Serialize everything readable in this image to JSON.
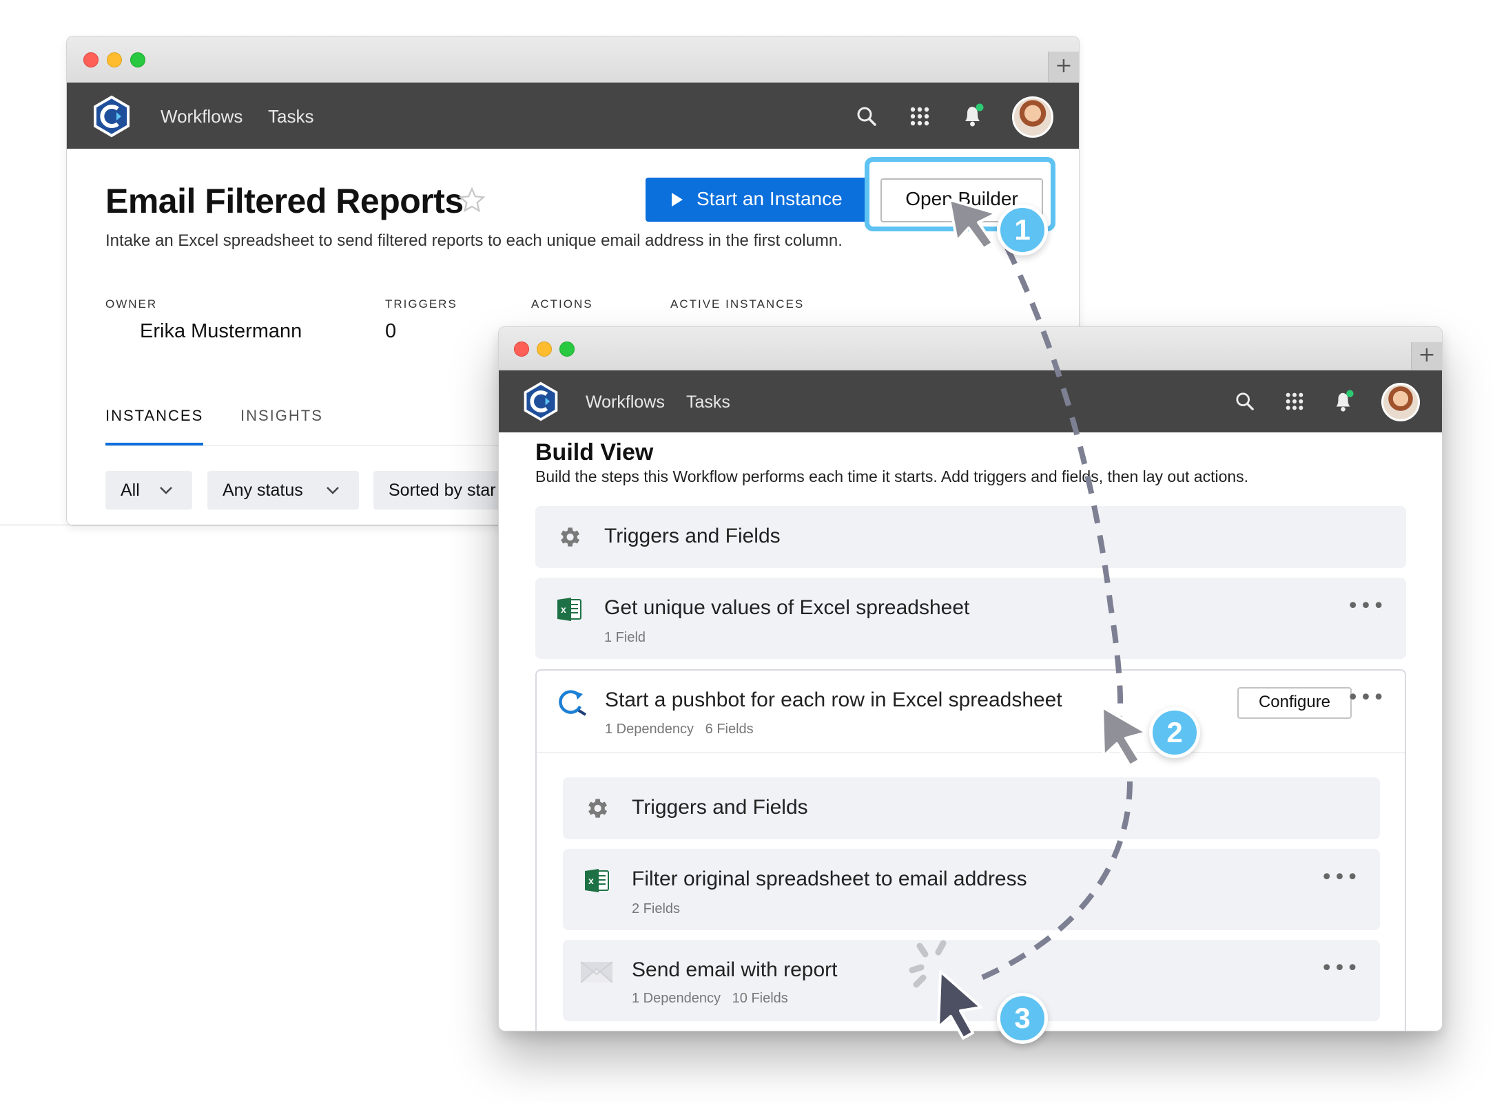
{
  "app": {
    "nav_links": [
      "Workflows",
      "Tasks"
    ],
    "icons": [
      "logo-icon",
      "search-icon",
      "apps-grid-icon",
      "bell-icon",
      "avatar"
    ],
    "accent_color": "#0b6fdc",
    "highlight_color": "#5ec2f2"
  },
  "overview": {
    "title": "Email Filtered Reports",
    "description": "Intake an Excel spreadsheet to send filtered reports to each unique email address in the first column.",
    "start_button": "Start an Instance",
    "open_builder_button": "Open Builder",
    "stats": [
      {
        "label": "OWNER",
        "value": "Erika Mustermann"
      },
      {
        "label": "TRIGGERS",
        "value": "0"
      },
      {
        "label": "ACTIONS",
        "value": ""
      },
      {
        "label": "ACTIVE INSTANCES",
        "value": ""
      }
    ],
    "tabs": [
      "INSTANCES",
      "INSIGHTS"
    ],
    "filters": [
      "All",
      "Any status",
      "Sorted by star"
    ]
  },
  "builder": {
    "title": "Build View",
    "description": "Build the steps this Workflow performs each time it starts. Add triggers and fields, then lay out actions.",
    "triggers_label": "Triggers and Fields",
    "step1": {
      "title": "Get unique values of Excel spreadsheet",
      "meta": "1 Field"
    },
    "step2": {
      "title": "Start a pushbot for each row in Excel spreadsheet",
      "meta": "1 Dependency   6 Fields",
      "configure": "Configure"
    },
    "nested_triggers_label": "Triggers and Fields",
    "nested1": {
      "title": "Filter original spreadsheet to email address",
      "meta": "2 Fields"
    },
    "nested2": {
      "title": "Send email with report",
      "meta": "1 Dependency   10 Fields"
    }
  },
  "annotations": {
    "badges": [
      "1",
      "2",
      "3"
    ]
  }
}
